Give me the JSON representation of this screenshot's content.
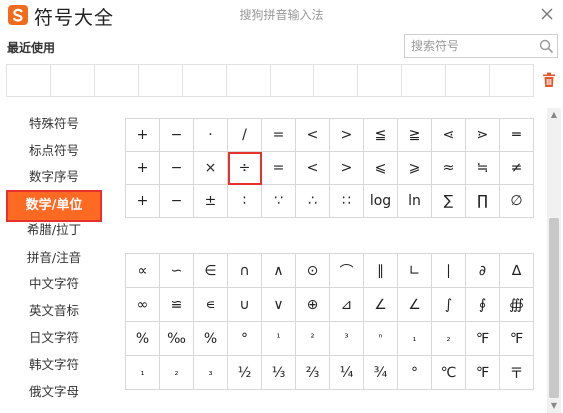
{
  "window": {
    "title": "符号大全",
    "ime_name": "搜狗拼音输入法"
  },
  "recent": {
    "label": "最近使用",
    "search_placeholder": "搜索符号"
  },
  "sidebar": {
    "items": [
      {
        "label": "特殊符号"
      },
      {
        "label": "标点符号"
      },
      {
        "label": "数字序号"
      },
      {
        "label": "数学/单位",
        "active": true
      },
      {
        "label": "希腊/拉丁"
      },
      {
        "label": "拼音/注音"
      },
      {
        "label": "中文字符"
      },
      {
        "label": "英文音标"
      },
      {
        "label": "日文字符"
      },
      {
        "label": "韩文字符"
      },
      {
        "label": "俄文字母"
      }
    ]
  },
  "grid1": [
    [
      "+",
      "−",
      "·",
      "/",
      "=",
      "<",
      ">",
      "≦",
      "≧",
      "⋖",
      "⋗",
      "═"
    ],
    [
      "+",
      "−",
      "×",
      "÷",
      "=",
      "<",
      ">",
      "⩽",
      "⩾",
      "≈",
      "≒",
      "≠"
    ],
    [
      "+",
      "−",
      "±",
      "∶",
      "∵",
      "∴",
      "∷",
      "log",
      "ln",
      "∑",
      "∏",
      "∅"
    ]
  ],
  "grid2": [
    [
      "∝",
      "∽",
      "∈",
      "∩",
      "∧",
      "⊙",
      "⌒",
      "∥",
      "∟",
      "∣",
      "∂",
      "∆"
    ],
    [
      "∞",
      "≌",
      "∊",
      "∪",
      "∨",
      "⊕",
      "⊿",
      "∠",
      "∠",
      "∫",
      "∮",
      "∰"
    ],
    [
      "%",
      "‰",
      "%",
      "°",
      "¹",
      "²",
      "³",
      "ⁿ",
      "₁",
      "₂",
      "℉",
      "℉"
    ],
    [
      "₁",
      "₂",
      "₃",
      "½",
      "⅓",
      "⅔",
      "¼",
      "¾",
      "°",
      "℃",
      "℉",
      "〒"
    ]
  ],
  "selected_symbol": "÷",
  "colors": {
    "accent": "#ff6a22",
    "selection_border": "#e5322f",
    "logo": "#f26a1b"
  },
  "icons": {
    "logo": "sogou-s-logo-icon",
    "close": "close-icon",
    "search": "search-icon",
    "trash": "trash-icon"
  }
}
